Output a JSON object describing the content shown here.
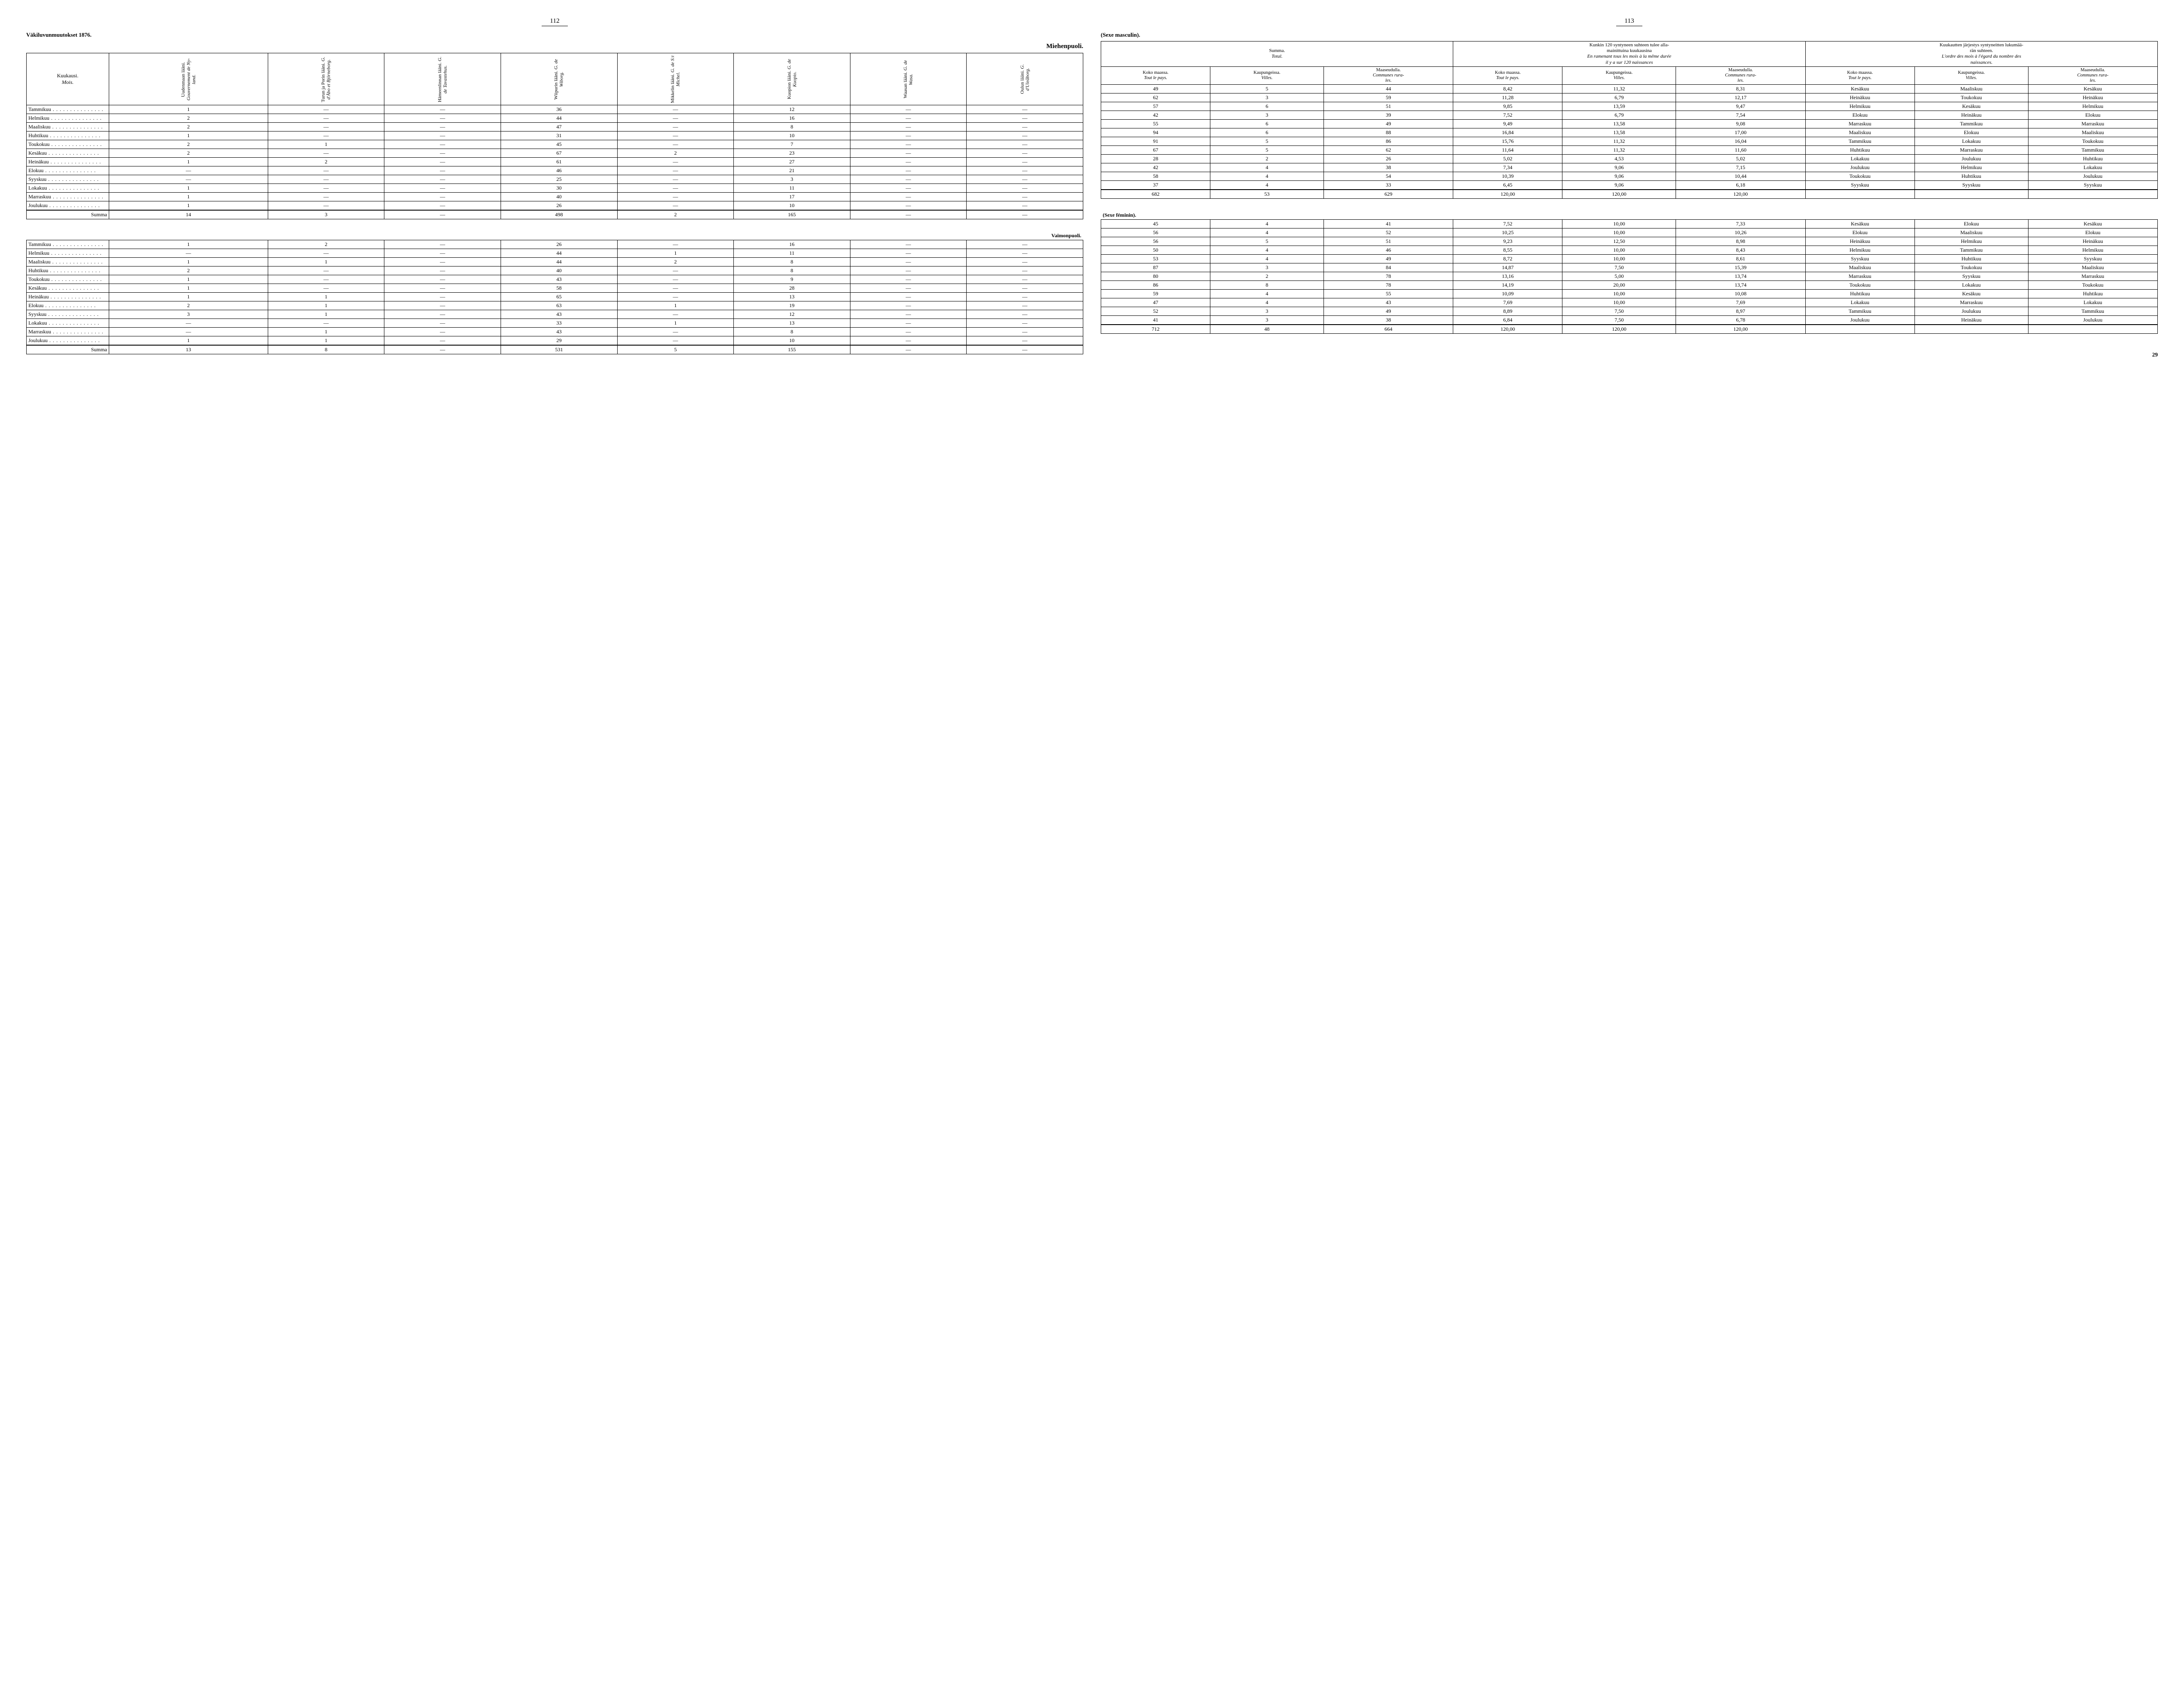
{
  "meta": {
    "corner_left": "Väkiluvunmuutokset 1876.",
    "page_left": "112",
    "page_right": "113",
    "foot_page": "29"
  },
  "left": {
    "male_title": "Miehenpuoli.",
    "female_title": "Vaimonpuoli.",
    "head_month": [
      "Kuukausi.",
      "Mois."
    ],
    "cols": [
      [
        "Uudenmaan lääni.",
        "Gouvernement de Ny-",
        "land."
      ],
      [
        "Turun ja Porin lääni.",
        "G. d'Åbo et Björneborg."
      ],
      [
        "Hämeenlinnan lääni.",
        "G. de Tavastehus."
      ],
      [
        "Wiipurin lääni.",
        "G. de Wiborg."
      ],
      [
        "Mikkelin lääni.",
        "G. de S:t Michel."
      ],
      [
        "Kuopion lääni.",
        "G. de Kuopio."
      ],
      [
        "Waasan lääni.",
        "G. de Wasa."
      ],
      [
        "Oulun lääni.",
        "G. d'Uleåborg."
      ]
    ],
    "months": [
      "Tammikuu",
      "Helmikuu",
      "Maaliskuu",
      "Huhtikuu",
      "Toukokuu",
      "Kesäkuu",
      "Heinäkuu",
      "Elokuu",
      "Syyskuu",
      "Lokakuu",
      "Marraskuu",
      "Joulukuu"
    ],
    "summa": "Summa",
    "male_rows": [
      [
        "1",
        "—",
        "—",
        "36",
        "—",
        "12",
        "—",
        "—"
      ],
      [
        "2",
        "—",
        "—",
        "44",
        "—",
        "16",
        "—",
        "—"
      ],
      [
        "2",
        "—",
        "—",
        "47",
        "—",
        "8",
        "—",
        "—"
      ],
      [
        "1",
        "—",
        "—",
        "31",
        "—",
        "10",
        "—",
        "—"
      ],
      [
        "2",
        "1",
        "—",
        "45",
        "—",
        "7",
        "—",
        "—"
      ],
      [
        "2",
        "—",
        "—",
        "67",
        "2",
        "23",
        "—",
        "—"
      ],
      [
        "1",
        "2",
        "—",
        "61",
        "—",
        "27",
        "—",
        "—"
      ],
      [
        "—",
        "—",
        "—",
        "46",
        "—",
        "21",
        "—",
        "—"
      ],
      [
        "—",
        "—",
        "—",
        "25",
        "—",
        "3",
        "—",
        "—"
      ],
      [
        "1",
        "—",
        "—",
        "30",
        "—",
        "11",
        "—",
        "—"
      ],
      [
        "1",
        "—",
        "—",
        "40",
        "—",
        "17",
        "—",
        "—"
      ],
      [
        "1",
        "—",
        "—",
        "26",
        "—",
        "10",
        "—",
        "—"
      ]
    ],
    "male_sum": [
      "14",
      "3",
      "—",
      "498",
      "2",
      "165",
      "—",
      "—"
    ],
    "female_rows": [
      [
        "1",
        "2",
        "—",
        "26",
        "—",
        "16",
        "—",
        "—"
      ],
      [
        "—",
        "—",
        "—",
        "44",
        "1",
        "11",
        "—",
        "—"
      ],
      [
        "1",
        "1",
        "—",
        "44",
        "2",
        "8",
        "—",
        "—"
      ],
      [
        "2",
        "—",
        "—",
        "40",
        "—",
        "8",
        "—",
        "—"
      ],
      [
        "1",
        "—",
        "—",
        "43",
        "—",
        "9",
        "—",
        "—"
      ],
      [
        "1",
        "—",
        "—",
        "58",
        "—",
        "28",
        "—",
        "—"
      ],
      [
        "1",
        "1",
        "—",
        "65",
        "—",
        "13",
        "—",
        "—"
      ],
      [
        "2",
        "1",
        "—",
        "63",
        "1",
        "19",
        "—",
        "—"
      ],
      [
        "3",
        "1",
        "—",
        "43",
        "—",
        "12",
        "—",
        "—"
      ],
      [
        "—",
        "—",
        "—",
        "33",
        "1",
        "13",
        "—",
        "—"
      ],
      [
        "—",
        "1",
        "—",
        "43",
        "—",
        "8",
        "—",
        "—"
      ],
      [
        "1",
        "1",
        "—",
        "29",
        "—",
        "10",
        "—",
        "—"
      ]
    ],
    "female_sum": [
      "13",
      "8",
      "—",
      "531",
      "5",
      "155",
      "—",
      "—"
    ]
  },
  "right": {
    "male_sub": "(Sexe masculin).",
    "female_sub": "(Sexe féminin).",
    "group_heads": [
      [
        "Summa.",
        "Total."
      ],
      [
        "Kunkin 120 syntyneen suhteen tulee alla-",
        "mainittuina kuukausina",
        "En ramenant tous les mois à la même durée",
        "il y a sur 120 naissances"
      ],
      [
        "Kuukautten järjestys syntyneitten lukumää-",
        "rän suhteen.",
        "L'ordre des mois à l'égard du nombre des",
        "naissances."
      ]
    ],
    "sub_heads": [
      [
        "Koko maassa.",
        "Tout le pays."
      ],
      [
        "Kaupungeissa.",
        "Villes."
      ],
      [
        "Maaseudulla.",
        "Communes rura-",
        "les."
      ],
      [
        "Koko maassa.",
        "Tout le pays."
      ],
      [
        "Kaupungeissa.",
        "Villes."
      ],
      [
        "Maaseudulla.",
        "Communes rura-",
        "les."
      ],
      [
        "Koko maassa.",
        "Tout le pays."
      ],
      [
        "Kaupungeissa.",
        "Villes."
      ],
      [
        "Maaseudulla.",
        "Communes rura-",
        "les."
      ]
    ],
    "male_rows": [
      [
        "49",
        "5",
        "44",
        "8,42",
        "11,32",
        "8,31",
        "Kesäkuu",
        "Maaliskuu",
        "Kesäkuu"
      ],
      [
        "62",
        "3",
        "59",
        "11,28",
        "6,79",
        "12,17",
        "Heinäkuu",
        "Toukokuu",
        "Heinäkuu"
      ],
      [
        "57",
        "6",
        "51",
        "9,85",
        "13,59",
        "9,47",
        "Helmikuu",
        "Kesäkuu",
        "Helmikuu"
      ],
      [
        "42",
        "3",
        "39",
        "7,52",
        "6,79",
        "7,54",
        "Elokuu",
        "Heinäkuu",
        "Elokuu"
      ],
      [
        "55",
        "6",
        "49",
        "9,49",
        "13,58",
        "9,08",
        "Marraskuu",
        "Tammikuu",
        "Marraskuu"
      ],
      [
        "94",
        "6",
        "88",
        "16,84",
        "13,58",
        "17,00",
        "Maaliskuu",
        "Elokuu",
        "Maaliskuu"
      ],
      [
        "91",
        "5",
        "86",
        "15,76",
        "11,32",
        "16,04",
        "Tammikuu",
        "Lokakuu",
        "Toukokuu"
      ],
      [
        "67",
        "5",
        "62",
        "11,64",
        "11,32",
        "11,60",
        "Huhtikuu",
        "Marraskuu",
        "Tammikuu"
      ],
      [
        "28",
        "2",
        "26",
        "5,02",
        "4,53",
        "5,02",
        "Lokakuu",
        "Joulukuu",
        "Huhtikuu"
      ],
      [
        "42",
        "4",
        "38",
        "7,34",
        "9,06",
        "7,15",
        "Joulukuu",
        "Helmikuu",
        "Lokakuu"
      ],
      [
        "58",
        "4",
        "54",
        "10,39",
        "9,06",
        "10,44",
        "Toukokuu",
        "Huhtikuu",
        "Joulukuu"
      ],
      [
        "37",
        "4",
        "33",
        "6,45",
        "9,06",
        "6,18",
        "Syyskuu",
        "Syyskuu",
        "Syyskuu"
      ]
    ],
    "male_sum": [
      "682",
      "53",
      "629",
      "120,00",
      "120,00",
      "120,00",
      "",
      "",
      ""
    ],
    "female_rows": [
      [
        "45",
        "4",
        "41",
        "7,52",
        "10,00",
        "7,33",
        "Kesäkuu",
        "Elokuu",
        "Kesäkuu"
      ],
      [
        "56",
        "4",
        "52",
        "10,25",
        "10,00",
        "10,26",
        "Elokuu",
        "Maaliskuu",
        "Elokuu"
      ],
      [
        "56",
        "5",
        "51",
        "9,23",
        "12,50",
        "8,98",
        "Heinäkuu",
        "Helmikuu",
        "Heinäkuu"
      ],
      [
        "50",
        "4",
        "46",
        "8,55",
        "10,00",
        "8,43",
        "Helmikuu",
        "Tammikuu",
        "Helmikuu"
      ],
      [
        "53",
        "4",
        "49",
        "8,72",
        "10,00",
        "8,61",
        "Syyskuu",
        "Huhtikuu",
        "Syyskuu"
      ],
      [
        "87",
        "3",
        "84",
        "14,87",
        "7,50",
        "15,39",
        "Maaliskuu",
        "Toukokuu",
        "Maaliskuu"
      ],
      [
        "80",
        "2",
        "78",
        "13,16",
        "5,00",
        "13,74",
        "Marraskuu",
        "Syyskuu",
        "Marraskuu"
      ],
      [
        "86",
        "8",
        "78",
        "14,19",
        "20,00",
        "13,74",
        "Toukokuu",
        "Lokakuu",
        "Toukokuu"
      ],
      [
        "59",
        "4",
        "55",
        "10,09",
        "10,00",
        "10,08",
        "Huhtikuu",
        "Kesäkuu",
        "Huhtikuu"
      ],
      [
        "47",
        "4",
        "43",
        "7,69",
        "10,00",
        "7,69",
        "Lokakuu",
        "Marraskuu",
        "Lokakuu"
      ],
      [
        "52",
        "3",
        "49",
        "8,89",
        "7,50",
        "8,97",
        "Tammikuu",
        "Joulukuu",
        "Tammikuu"
      ],
      [
        "41",
        "3",
        "38",
        "6,84",
        "7,50",
        "6,78",
        "Joulukuu",
        "Heinäkuu",
        "Joulukuu"
      ]
    ],
    "female_sum": [
      "712",
      "48",
      "664",
      "120,00",
      "120,00",
      "120,00",
      "",
      "",
      ""
    ]
  }
}
